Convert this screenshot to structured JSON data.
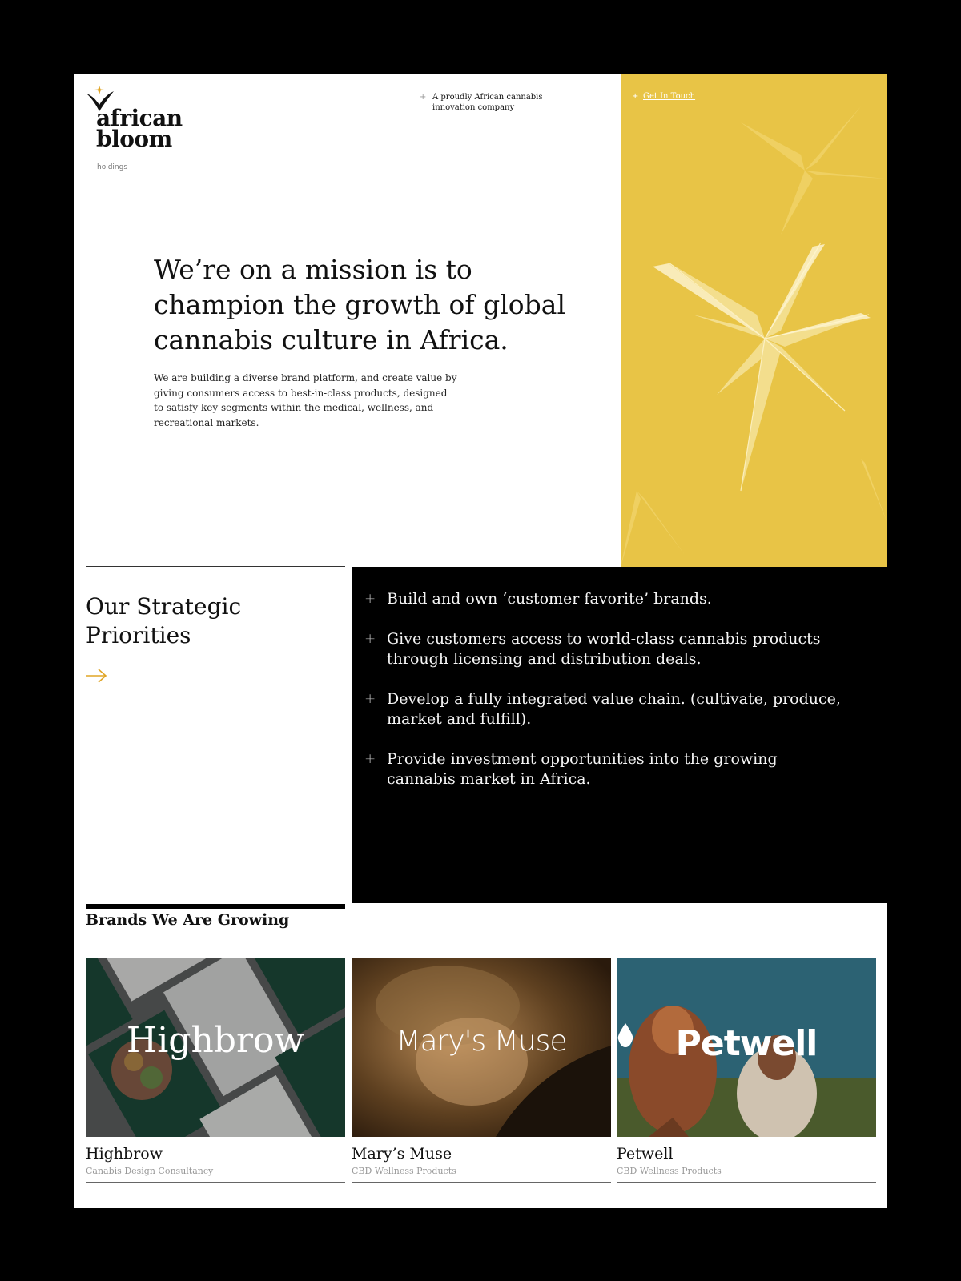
{
  "header": {
    "logo_line1": "african",
    "logo_line2": "bloom",
    "logo_sub": "holdings",
    "tagline": "A proudly African cannabis innovation company",
    "cta": "Get In Touch"
  },
  "hero": {
    "title": "We’re on a mission is to champion the growth of global cannabis culture in Africa.",
    "body": "We are building a diverse brand platform, and create value by giving consumers access to best-in-class products, designed to satisfy key segments within the medical, wellness, and recreational markets."
  },
  "priorities": {
    "heading": "Our Strategic Priorities",
    "items": [
      "Build and own ‘customer favorite’ brands.",
      "Give customers access to world-class cannabis products through licensing and distribution deals.",
      "Develop a fully integrated value chain. (cultivate, produce, market and fulfill).",
      "Provide investment opportunities into the growing cannabis market in Africa."
    ]
  },
  "brands": {
    "heading": "Brands We Are Growing",
    "items": [
      {
        "logo": "Highbrow",
        "name": "Highbrow",
        "desc": "Canabis Design Consultancy"
      },
      {
        "logo": "Mary's Muse",
        "name": "Mary’s Muse",
        "desc": "CBD Wellness Products"
      },
      {
        "logo": "Petwell",
        "name": "Petwell",
        "desc": "CBD Wellness Products"
      }
    ]
  },
  "colors": {
    "accent": "#e0a526",
    "panel_yellow": "#e8c446",
    "black": "#000000"
  },
  "icons": [
    "star-leaf-logo-icon",
    "plus-icon",
    "arrow-right-icon",
    "droplet-icon"
  ]
}
